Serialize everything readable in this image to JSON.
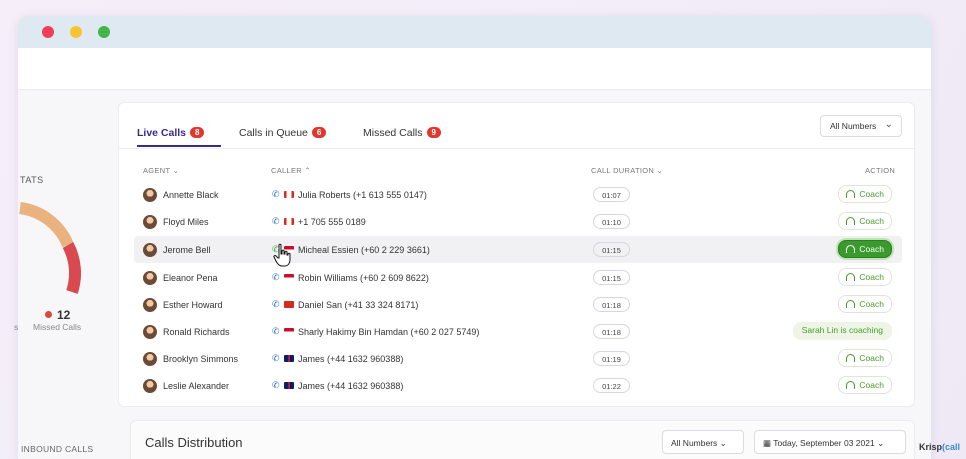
{
  "stats": {
    "title": "TATS",
    "missed_count": "12",
    "missed_label": "Missed Calls",
    "partial_left_label": "s",
    "inbound_label": "INBOUND CALLS"
  },
  "tabs": [
    {
      "label": "Live Calls",
      "badge": "8"
    },
    {
      "label": "Calls in Queue",
      "badge": "6"
    },
    {
      "label": "Missed Calls",
      "badge": "9"
    }
  ],
  "numbers_filter": "All Numbers",
  "columns": {
    "agent": "AGENT",
    "caller": "CALLER",
    "duration": "CALL DURATION",
    "action": "ACTION"
  },
  "rows": [
    {
      "agent": "Annette Black",
      "caller": "Julia Roberts (+1 613 555 0147)",
      "duration": "01:07",
      "action": "Coach"
    },
    {
      "agent": "Floyd Miles",
      "caller": "+1 705 555 0189",
      "duration": "01:10",
      "action": "Coach"
    },
    {
      "agent": "Jerome Bell",
      "caller": "Micheal Essien (+60 2 229 3661)",
      "duration": "01:15",
      "action": "Coach"
    },
    {
      "agent": "Eleanor Pena",
      "caller": "Robin Williams (+60 2 609 8622)",
      "duration": "01:15",
      "action": "Coach"
    },
    {
      "agent": "Esther Howard",
      "caller": "Daniel San (+41 33 324 8171)",
      "duration": "01:18",
      "action": "Coach"
    },
    {
      "agent": "Ronald Richards",
      "caller": "Sharly Hakimy Bin Hamdan (+60 2 027 5749)",
      "duration": "01:18",
      "action": "Sarah Lin is coaching"
    },
    {
      "agent": "Brooklyn Simmons",
      "caller": "James (+44 1632 960388)",
      "duration": "01:19",
      "action": "Coach"
    },
    {
      "agent": "Leslie Alexander",
      "caller": "James (+44 1632 960388)",
      "duration": "01:22",
      "action": "Coach"
    }
  ],
  "distribution": {
    "title": "Calls Distribution",
    "numbers_filter": "All Numbers",
    "date_filter": "Today, September 03 2021"
  },
  "brand": {
    "prefix": "Krisp",
    "suffix": "call"
  },
  "colors": {
    "accent": "#3b2a8a",
    "badge": "#e0382f",
    "coach": "#4a9a2c"
  }
}
